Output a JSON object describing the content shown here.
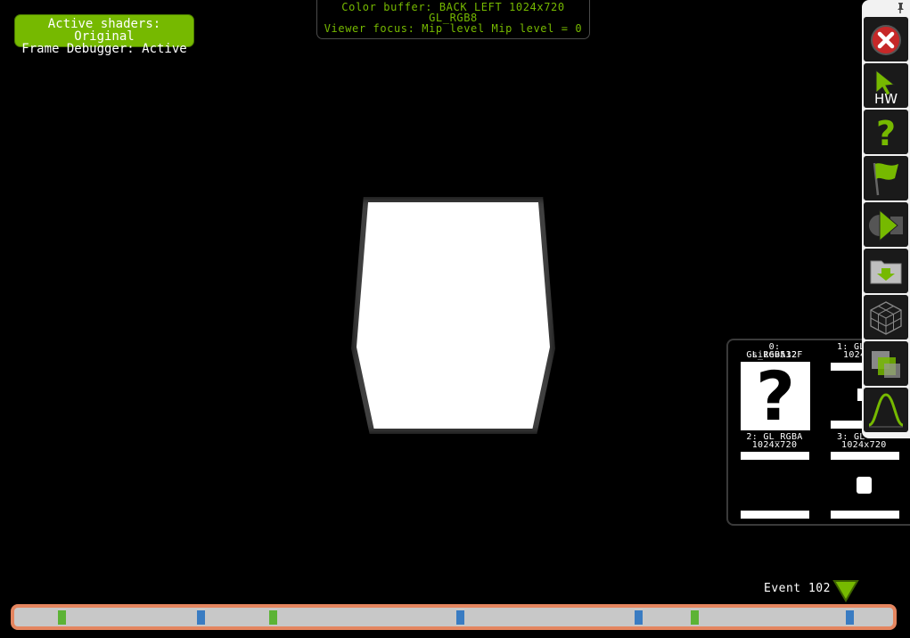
{
  "status": {
    "line1": "Active shaders: Original",
    "line2": "Frame Debugger: Active"
  },
  "buffer_info": {
    "line1": "Color buffer: BACK LEFT 1024x720",
    "line2": "GL_RGB8",
    "line3": "Viewer focus: Mip level Mip level = 0"
  },
  "textures": [
    {
      "title": "0: GL_RGBA32F",
      "subtitle": "size=512"
    },
    {
      "title": "1: GL",
      "subtitle": "1024"
    },
    {
      "title": "2: GL_RGBA",
      "subtitle": "1024x720"
    },
    {
      "title": "3: GL",
      "subtitle": "1024x720"
    }
  ],
  "toolbar": {
    "hw_label": "HW",
    "icons": [
      "close-icon",
      "cursor-hw-icon",
      "help-icon",
      "flag-icon",
      "play-icon",
      "save-folder-icon",
      "wireframe-cube-icon",
      "overlay-icon",
      "curve-icon"
    ]
  },
  "event": {
    "label": "Event 102"
  },
  "timeline": {
    "ticks": [
      {
        "type": "green",
        "pos": 0.0495
      },
      {
        "type": "blue",
        "pos": 0.2075
      },
      {
        "type": "green",
        "pos": 0.29
      },
      {
        "type": "blue",
        "pos": 0.503
      },
      {
        "type": "blue",
        "pos": 0.7055
      },
      {
        "type": "green",
        "pos": 0.7695
      },
      {
        "type": "blue",
        "pos": 0.9465
      }
    ]
  },
  "colors": {
    "accent": "#76b900",
    "timeline_border": "#e4855f",
    "tick_green": "#5cb335",
    "tick_blue": "#3a7cc2"
  }
}
